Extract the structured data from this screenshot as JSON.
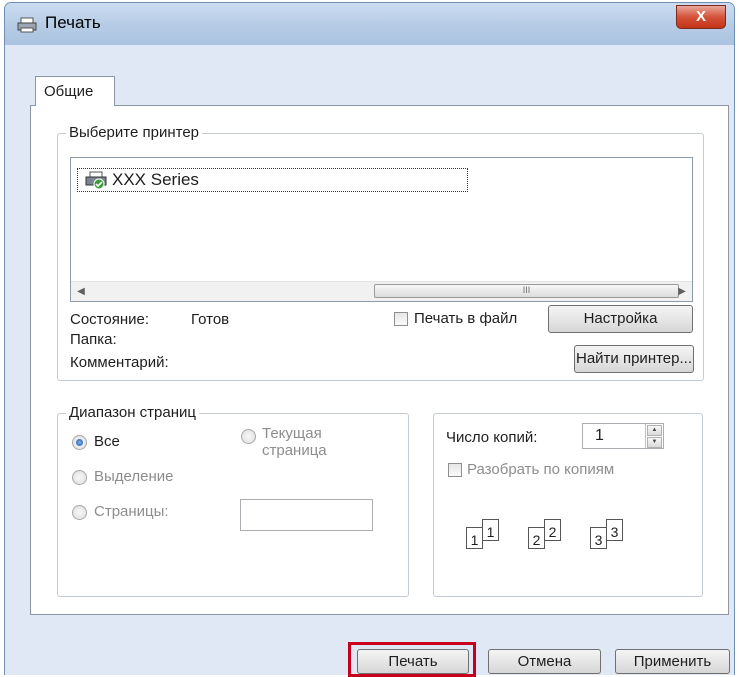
{
  "window": {
    "title": "Печать",
    "close_label": "X",
    "title_icon": "printer-icon"
  },
  "tabs": [
    {
      "label": "Общие",
      "selected": true
    }
  ],
  "printer_group": {
    "legend": "Выберите принтер",
    "printers": [
      {
        "name": "XXX Series",
        "icon": "printer-ready-icon",
        "selected": true
      }
    ],
    "scrollbar_grip": "III"
  },
  "status": {
    "state_label": "Состояние:",
    "state_value": "Готов",
    "folder_label": "Папка:",
    "comment_label": "Комментарий:",
    "print_to_file_label": "Печать в файл",
    "print_to_file_checked": false,
    "settings_button": "Настройка",
    "find_printer_button": "Найти принтер..."
  },
  "page_range": {
    "legend": "Диапазон страниц",
    "all_label": "Все",
    "current_page_label_1": "Текущая",
    "current_page_label_2": "страница",
    "selection_label": "Выделение",
    "pages_label": "Страницы:",
    "pages_value": ""
  },
  "copies": {
    "label": "Число копий:",
    "value": "1",
    "collate_label": "Разобрать по копиям",
    "collate_checked": false,
    "sheet_labels": [
      "1",
      "1",
      "2",
      "2",
      "3",
      "3"
    ]
  },
  "buttons": {
    "print": "Печать",
    "cancel": "Отмена",
    "apply": "Применить"
  },
  "colors": {
    "highlight": "#c8001e",
    "window_frame": "#dfe8f4"
  }
}
